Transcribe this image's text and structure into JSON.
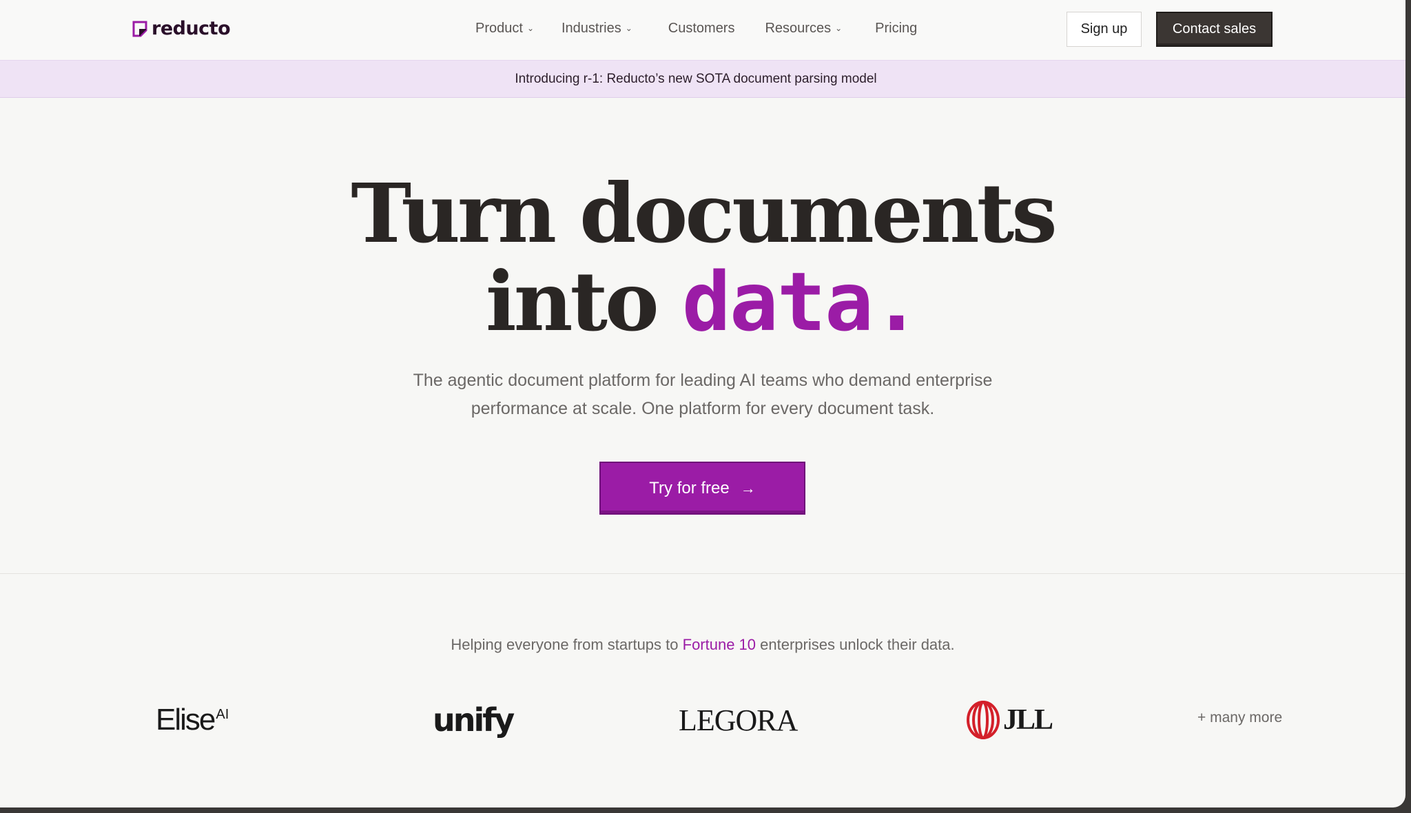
{
  "nav": {
    "logo_text": "reducto",
    "menu": [
      {
        "label": "Product",
        "dropdown": true
      },
      {
        "label": "Industries",
        "dropdown": true
      },
      {
        "label": "Customers",
        "dropdown": false
      },
      {
        "label": "Resources",
        "dropdown": true
      },
      {
        "label": "Pricing",
        "dropdown": false
      }
    ],
    "chevron_icon": "chevron-down-icon",
    "signup_label": "Sign up",
    "contact_label": "Contact sales"
  },
  "banner": {
    "text": "Introducing r‑1: Reducto’s new SOTA document parsing model"
  },
  "hero": {
    "title_line1": "Turn documents",
    "title_line2_prefix": "into ",
    "title_line2_accent": "data.",
    "subtitle_line1": "The agentic document platform for leading AI teams who demand enterprise",
    "subtitle_line2": "performance at scale. One platform for every document task.",
    "cta_label": "Try for free",
    "cta_icon": "arrow-right-icon"
  },
  "customers": {
    "tagline_prefix": "Helping everyone from startups to ",
    "tagline_accent": "Fortune 10",
    "tagline_suffix": " enterprises unlock their data.",
    "logos": {
      "elise": "Elise",
      "elise_sup": "AI",
      "unify": "unify",
      "legora": "LEGORA",
      "jll": "JLL"
    },
    "more_label": "+ many more"
  },
  "colors": {
    "accent": "#9b1ca6",
    "banner_bg": "#efe3f5",
    "dark_button": "#3b3633",
    "page_bg": "#f7f7f5"
  }
}
